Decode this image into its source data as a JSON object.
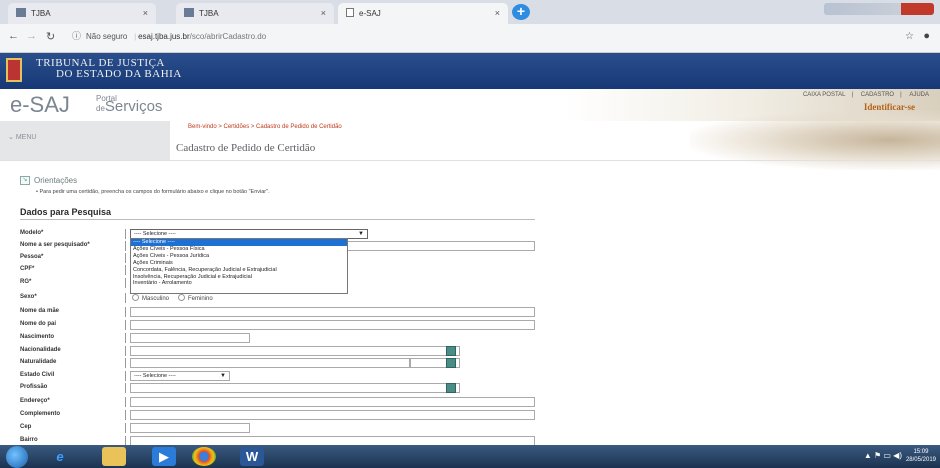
{
  "browser": {
    "tabs": [
      {
        "title": "TJBA",
        "active": false
      },
      {
        "title": "TJBA",
        "active": false
      },
      {
        "title": "e-SAJ",
        "active": true
      }
    ],
    "new_tab": "+",
    "address": {
      "security_label": "Não seguro",
      "host": "esaj.tjba.jus.br",
      "path": "/sco/abrirCadastro.do"
    }
  },
  "header": {
    "line1": "TRIBUNAL DE JUSTIÇA",
    "line2": "DO ESTADO DA BAHIA"
  },
  "banner": {
    "logo": "e-SAJ",
    "portal_small": "Portal",
    "portal_de": "de",
    "portal_big": "Serviços",
    "links": [
      "CAIXA POSTAL",
      "CADASTRO",
      "AJUDA"
    ],
    "link_separator": "|",
    "login": "Identificar-se"
  },
  "menu": {
    "label": "MENU",
    "breadcrumb": "Bem-vindo > Certidões > Cadastro de Pedido de Certidão",
    "page_title": "Cadastro de Pedido de Certidão"
  },
  "orientacoes": {
    "title": "Orientações",
    "text": "Para pedir uma certidão, preencha os campos do formulário abaixo e clique no botão \"Enviar\"."
  },
  "form": {
    "section_title": "Dados para Pesquisa",
    "labels": {
      "modelo": "Modelo*",
      "nome": "Nome a ser pesquisado*",
      "pessoa": "Pessoa*",
      "cpf": "CPF*",
      "rg": "RG*",
      "sexo": "Sexo*",
      "mae": "Nome da mãe",
      "pai": "Nome do pai",
      "nascimento": "Nascimento",
      "nacionalidade": "Nacionalidade",
      "naturalidade": "Naturalidade",
      "estado_civil": "Estado Civil",
      "profissao": "Profissão",
      "endereco": "Endereço*",
      "complemento": "Complemento",
      "cep": "Cep",
      "bairro": "Bairro"
    },
    "modelo_value": "---- Selecione ----",
    "estado_civil_value": "---- Selecione ----",
    "sexo_options": [
      "Masculino",
      "Feminino"
    ],
    "modelo_options": [
      "---- Selecione ----",
      "Ações Cíveis - Pessoa Física",
      "Ações Cíveis - Pessoa Jurídica",
      "Ações Criminais",
      "Concordata, Falência, Recuperação Judicial e Extrajudicial",
      "Insolvência, Recuperação Judicial e Extrajudicial",
      "Inventário - Arrolamento"
    ]
  },
  "taskbar": {
    "time": "15:09",
    "date": "28/05/2019"
  }
}
